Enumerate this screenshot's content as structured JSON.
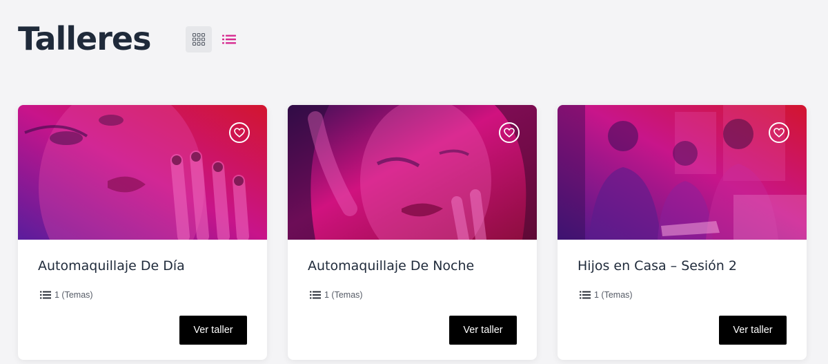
{
  "page": {
    "title": "Talleres"
  },
  "view_toggle": {
    "grid": {
      "icon": "grid-icon",
      "active": true
    },
    "list": {
      "icon": "list-icon",
      "active": false,
      "color": "#d6298f"
    }
  },
  "colors": {
    "title": "#1f2a3a",
    "button_bg": "#000000",
    "gradient_pink": "#e0117e",
    "gradient_purple": "#5a1d9c",
    "gradient_red": "#d2152f"
  },
  "cards": [
    {
      "title": "Automaquillaje De Día",
      "topics": "1 (Temas)",
      "button": "Ver taller",
      "favorite_icon": "heart-icon",
      "meta_icon": "list-icon"
    },
    {
      "title": "Automaquillaje De Noche",
      "topics": "1 (Temas)",
      "button": "Ver taller",
      "favorite_icon": "heart-icon",
      "meta_icon": "list-icon"
    },
    {
      "title": "Hijos en Casa – Sesión 2",
      "topics": "1 (Temas)",
      "button": "Ver taller",
      "favorite_icon": "heart-icon",
      "meta_icon": "list-icon"
    }
  ]
}
